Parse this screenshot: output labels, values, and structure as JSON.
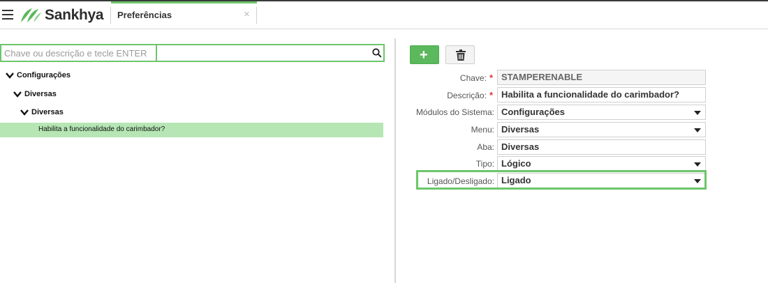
{
  "header": {
    "logo_text": "Sankhya",
    "tab_label": "Preferências",
    "tab_close": "×"
  },
  "search": {
    "placeholder": "Chave ou descrição e tecle ENTER",
    "value": ""
  },
  "tree": {
    "nodes": [
      {
        "label": "Configurações",
        "level": 0
      },
      {
        "label": "Diversas",
        "level": 1
      },
      {
        "label": "Diversas",
        "level": 2
      }
    ],
    "selected_leaf": "Habilita a funcionalidade do carimbador?"
  },
  "toolbar": {
    "add_label": "+"
  },
  "form": {
    "chave": {
      "label": "Chave:",
      "value": "STAMPERENABLE",
      "required": "*"
    },
    "descricao": {
      "label": "Descrição:",
      "value": "Habilita a funcionalidade do carimbador?",
      "required": "*"
    },
    "modulos": {
      "label": "Módulos do Sistema:",
      "value": "Configurações"
    },
    "menu": {
      "label": "Menu:",
      "value": "Diversas"
    },
    "aba": {
      "label": "Aba:",
      "value": "Diversas"
    },
    "tipo": {
      "label": "Tipo:",
      "value": "Lógico"
    },
    "ligado": {
      "label": "Ligado/Desligado:",
      "value": "Ligado"
    }
  },
  "colors": {
    "accent_green": "#6cc66b",
    "selected_row": "#b5e6b4",
    "required_star": "#d9363e"
  }
}
